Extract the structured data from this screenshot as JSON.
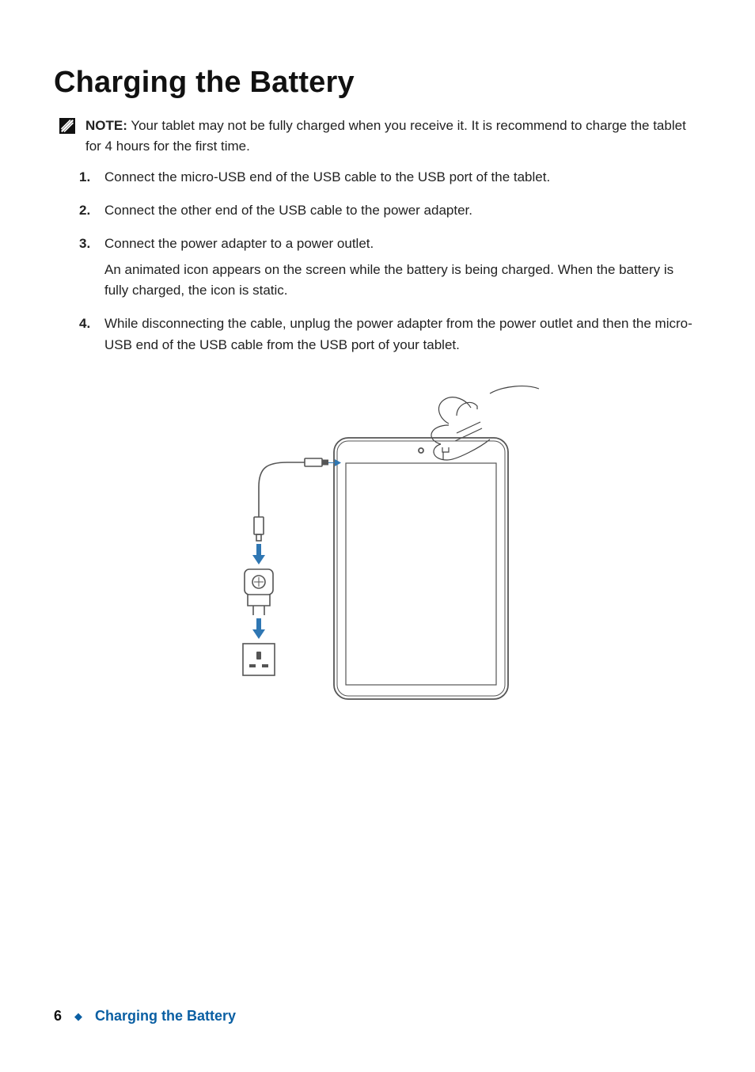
{
  "heading": "Charging the Battery",
  "note": {
    "label": "NOTE:",
    "text": "Your tablet may not be fully charged when you receive it. It is recommend to charge the tablet for 4 hours for the first time."
  },
  "steps": [
    {
      "text": "Connect the micro-USB end of the USB cable to the USB port of the tablet."
    },
    {
      "text": "Connect the other end of the USB cable to the power adapter."
    },
    {
      "text": "Connect the power adapter to a power outlet.",
      "sub": "An animated icon appears on the screen while the battery is being charged. When the battery is fully charged, the icon is static."
    },
    {
      "text": "While disconnecting the cable, unplug the power adapter from the power outlet and then the micro-USB end of the USB cable from the USB port of your tablet."
    }
  ],
  "footer": {
    "page_number": "6",
    "section": "Charging the Battery"
  }
}
